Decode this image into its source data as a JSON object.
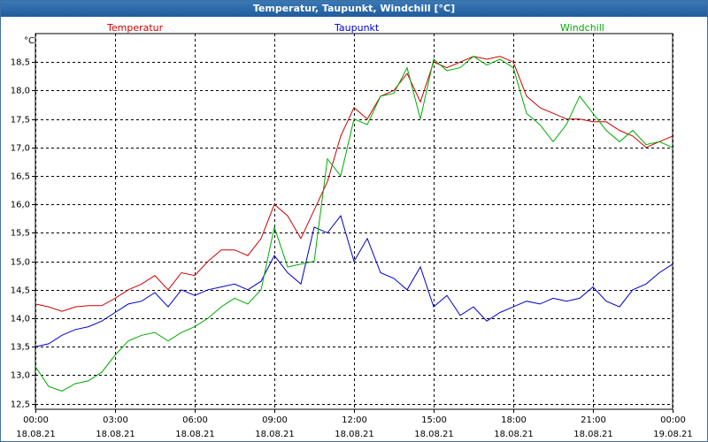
{
  "window": {
    "title": "Temperatur, Taupunkt, Windchill [°C]"
  },
  "chart_data": {
    "type": "line",
    "title": "Temperatur, Taupunkt, Windchill [°C]",
    "ylabel": "°C",
    "ylim": [
      12.4,
      19.0
    ],
    "xlim": [
      0,
      24
    ],
    "yticks": [
      "12,5",
      "13,0",
      "13,5",
      "14,0",
      "14,5",
      "15,0",
      "15,5",
      "16,0",
      "16,5",
      "17,0",
      "17,5",
      "18,0",
      "18,5"
    ],
    "yticks_values": [
      12.5,
      13.0,
      13.5,
      14.0,
      14.5,
      15.0,
      15.5,
      16.0,
      16.5,
      17.0,
      17.5,
      18.0,
      18.5
    ],
    "xticks": [
      {
        "value": 0,
        "time": "00:00",
        "date": "18.08.21"
      },
      {
        "value": 3,
        "time": "03:00",
        "date": "18.08.21"
      },
      {
        "value": 6,
        "time": "06:00",
        "date": "18.08.21"
      },
      {
        "value": 9,
        "time": "09:00",
        "date": "18.08.21"
      },
      {
        "value": 12,
        "time": "12:00",
        "date": "18.08.21"
      },
      {
        "value": 15,
        "time": "15:00",
        "date": "18.08.21"
      },
      {
        "value": 18,
        "time": "18:00",
        "date": "18.08.21"
      },
      {
        "value": 21,
        "time": "21:00",
        "date": "18.08.21"
      },
      {
        "value": 24,
        "time": "00:00",
        "date": "19.08.21"
      }
    ],
    "grid": true,
    "legend": "top",
    "series": [
      {
        "name": "Temperatur",
        "color": "#cc0000",
        "points": [
          [
            0,
            14.25
          ],
          [
            0.5,
            14.2
          ],
          [
            1,
            14.12
          ],
          [
            1.5,
            14.2
          ],
          [
            2,
            14.22
          ],
          [
            2.5,
            14.22
          ],
          [
            3,
            14.35
          ],
          [
            3.5,
            14.5
          ],
          [
            4,
            14.6
          ],
          [
            4.5,
            14.75
          ],
          [
            5,
            14.5
          ],
          [
            5.5,
            14.8
          ],
          [
            6,
            14.75
          ],
          [
            6.5,
            15.0
          ],
          [
            7,
            15.2
          ],
          [
            7.5,
            15.2
          ],
          [
            8,
            15.1
          ],
          [
            8.5,
            15.4
          ],
          [
            9,
            16.0
          ],
          [
            9.5,
            15.8
          ],
          [
            10,
            15.4
          ],
          [
            10.5,
            15.9
          ],
          [
            11,
            16.4
          ],
          [
            11.5,
            17.2
          ],
          [
            12,
            17.7
          ],
          [
            12.5,
            17.5
          ],
          [
            13,
            17.9
          ],
          [
            13.5,
            18.0
          ],
          [
            14,
            18.3
          ],
          [
            14.5,
            17.8
          ],
          [
            15,
            18.5
          ],
          [
            15.5,
            18.4
          ],
          [
            16,
            18.5
          ],
          [
            16.5,
            18.6
          ],
          [
            17,
            18.55
          ],
          [
            17.5,
            18.6
          ],
          [
            18,
            18.5
          ],
          [
            18.5,
            17.9
          ],
          [
            19,
            17.7
          ],
          [
            19.5,
            17.6
          ],
          [
            20,
            17.5
          ],
          [
            20.5,
            17.5
          ],
          [
            21,
            17.45
          ],
          [
            21.5,
            17.45
          ],
          [
            22,
            17.3
          ],
          [
            22.5,
            17.2
          ],
          [
            23,
            17.0
          ],
          [
            23.5,
            17.1
          ],
          [
            24,
            17.2
          ]
        ]
      },
      {
        "name": "Taupunkt",
        "color": "#0000cc",
        "points": [
          [
            0,
            13.5
          ],
          [
            0.5,
            13.55
          ],
          [
            1,
            13.7
          ],
          [
            1.5,
            13.8
          ],
          [
            2,
            13.85
          ],
          [
            2.5,
            13.95
          ],
          [
            3,
            14.1
          ],
          [
            3.5,
            14.25
          ],
          [
            4,
            14.3
          ],
          [
            4.5,
            14.45
          ],
          [
            5,
            14.2
          ],
          [
            5.5,
            14.5
          ],
          [
            6,
            14.4
          ],
          [
            6.5,
            14.5
          ],
          [
            7,
            14.55
          ],
          [
            7.5,
            14.6
          ],
          [
            8,
            14.5
          ],
          [
            8.5,
            14.65
          ],
          [
            9,
            15.1
          ],
          [
            9.5,
            14.8
          ],
          [
            10,
            14.6
          ],
          [
            10.5,
            15.6
          ],
          [
            11,
            15.5
          ],
          [
            11.5,
            15.8
          ],
          [
            12,
            15.0
          ],
          [
            12.5,
            15.4
          ],
          [
            13,
            14.8
          ],
          [
            13.5,
            14.7
          ],
          [
            14,
            14.5
          ],
          [
            14.5,
            14.9
          ],
          [
            15,
            14.2
          ],
          [
            15.5,
            14.4
          ],
          [
            16,
            14.05
          ],
          [
            16.5,
            14.2
          ],
          [
            17,
            13.95
          ],
          [
            17.5,
            14.1
          ],
          [
            18,
            14.2
          ],
          [
            18.5,
            14.3
          ],
          [
            19,
            14.25
          ],
          [
            19.5,
            14.35
          ],
          [
            20,
            14.3
          ],
          [
            20.5,
            14.35
          ],
          [
            21,
            14.55
          ],
          [
            21.5,
            14.3
          ],
          [
            22,
            14.2
          ],
          [
            22.5,
            14.5
          ],
          [
            23,
            14.6
          ],
          [
            23.5,
            14.8
          ],
          [
            24,
            14.95
          ]
        ]
      },
      {
        "name": "Windchill",
        "color": "#00aa00",
        "points": [
          [
            0,
            13.15
          ],
          [
            0.5,
            12.8
          ],
          [
            1,
            12.72
          ],
          [
            1.5,
            12.85
          ],
          [
            2,
            12.9
          ],
          [
            2.5,
            13.05
          ],
          [
            3,
            13.35
          ],
          [
            3.5,
            13.6
          ],
          [
            4,
            13.7
          ],
          [
            4.5,
            13.75
          ],
          [
            5,
            13.6
          ],
          [
            5.5,
            13.75
          ],
          [
            6,
            13.85
          ],
          [
            6.5,
            14.0
          ],
          [
            7,
            14.2
          ],
          [
            7.5,
            14.35
          ],
          [
            8,
            14.25
          ],
          [
            8.5,
            14.5
          ],
          [
            9,
            15.6
          ],
          [
            9.5,
            14.9
          ],
          [
            10,
            14.95
          ],
          [
            10.5,
            15.0
          ],
          [
            11,
            16.8
          ],
          [
            11.5,
            16.5
          ],
          [
            12,
            17.5
          ],
          [
            12.5,
            17.4
          ],
          [
            13,
            17.9
          ],
          [
            13.5,
            17.95
          ],
          [
            14,
            18.4
          ],
          [
            14.5,
            17.5
          ],
          [
            15,
            18.55
          ],
          [
            15.5,
            18.35
          ],
          [
            16,
            18.4
          ],
          [
            16.5,
            18.6
          ],
          [
            17,
            18.45
          ],
          [
            17.5,
            18.55
          ],
          [
            18,
            18.4
          ],
          [
            18.5,
            17.6
          ],
          [
            19,
            17.4
          ],
          [
            19.5,
            17.1
          ],
          [
            20,
            17.4
          ],
          [
            20.5,
            17.9
          ],
          [
            21,
            17.6
          ],
          [
            21.5,
            17.3
          ],
          [
            22,
            17.1
          ],
          [
            22.5,
            17.3
          ],
          [
            23,
            17.05
          ],
          [
            23.5,
            17.1
          ],
          [
            24,
            17.0
          ]
        ]
      }
    ]
  }
}
